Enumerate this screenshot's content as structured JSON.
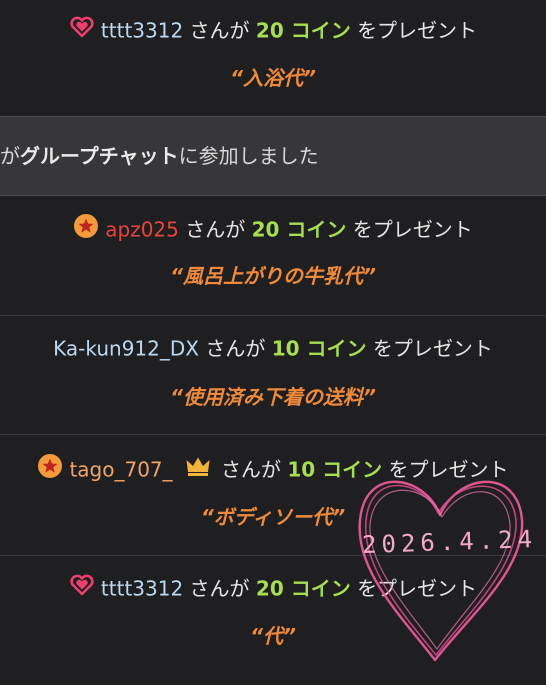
{
  "feed": {
    "entries": [
      {
        "badge": "heart-badge-icon",
        "username": "tttt3312",
        "san": "さんが",
        "coins": "20 コイン",
        "action": "をプレゼント",
        "message": "“入浴代”"
      },
      {
        "badge": "star-badge-icon",
        "username": "apz025",
        "san": "さんが",
        "coins": "20 コイン",
        "action": "をプレゼント",
        "message": "“風呂上がりの牛乳代”"
      },
      {
        "username": "Ka-kun912_DX",
        "san": "さんが",
        "coins": "10 コイン",
        "action": "をプレゼント",
        "message": "“使用済み下着の送料”"
      },
      {
        "badge": "star-badge-icon",
        "crown": "crown-icon",
        "username": "tago_707_",
        "san": "さんが",
        "coins": "10 コイン",
        "action": "をプレゼント",
        "message": "“ボディソー代”"
      },
      {
        "badge": "heart-badge-icon",
        "username": "tttt3312",
        "san": "さんが",
        "coins": "20 コイン",
        "action": "をプレゼント",
        "message": "“代”"
      }
    ],
    "system_message": {
      "prefix": "が",
      "bold": "グループチャット",
      "suffix": "に参加しました"
    }
  },
  "overlay": {
    "date": "2026.4.24",
    "heart_color": "#e85a9a"
  },
  "colors": {
    "background": "#1f1f21",
    "coins": "#a7dd52",
    "message": "#ef8a3d",
    "username_blue": "#bcd9f2",
    "username_red": "#e8443a",
    "username_orange": "#f0a46a"
  }
}
